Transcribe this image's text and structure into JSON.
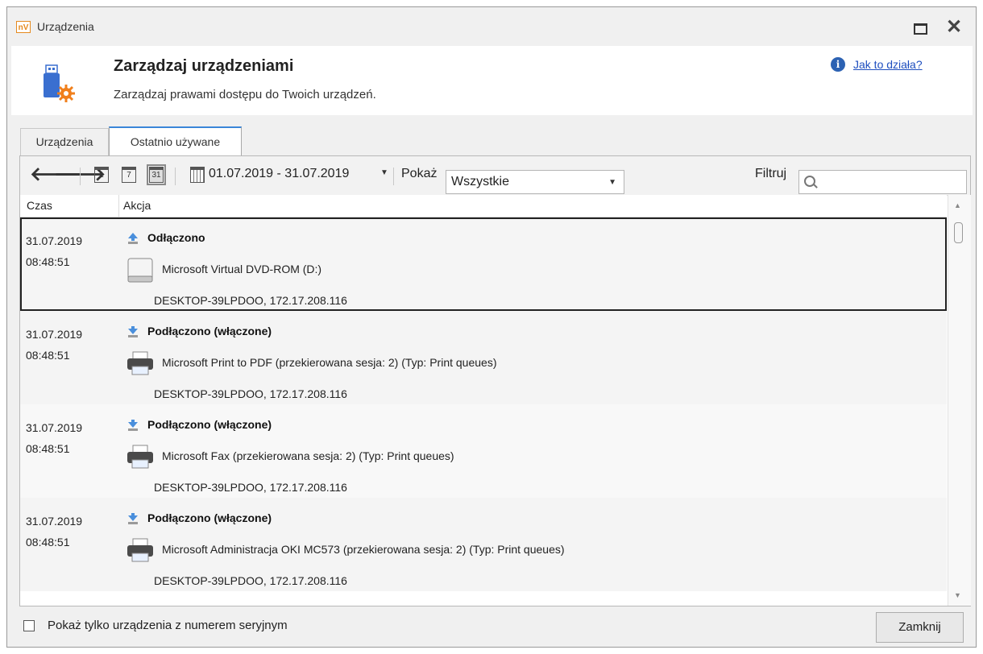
{
  "window": {
    "title": "Urządzenia",
    "logo_text": "nV"
  },
  "header": {
    "title": "Zarządzaj urządzeniami",
    "subtitle": "Zarządzaj prawami dostępu do Twoich urządzeń.",
    "help_link": "Jak to działa?"
  },
  "tabs": [
    {
      "label": "Urządzenia",
      "active": false
    },
    {
      "label": "Ostatnio używane",
      "active": true
    }
  ],
  "toolbar": {
    "calendar_day": "1",
    "calendar_week": "7",
    "calendar_month": "31",
    "date_range": "01.07.2019 - 31.07.2019",
    "show_label": "Pokaż",
    "show_value": "Wszystkie",
    "filter_label": "Filtruj",
    "filter_value": ""
  },
  "columns": {
    "time": "Czas",
    "action": "Akcja"
  },
  "rows": [
    {
      "date": "31.07.2019",
      "time": "08:48:51",
      "action": "Odłączono",
      "action_icon": "eject-icon",
      "device": "Microsoft Virtual DVD-ROM (D:)",
      "device_icon": "drive-icon",
      "host": "DESKTOP-39LPDOO, 172.17.208.116",
      "selected": true
    },
    {
      "date": "31.07.2019",
      "time": "08:48:51",
      "action": "Podłączono (włączone)",
      "action_icon": "connect-icon",
      "device": "Microsoft Print to PDF (przekierowana sesja: 2) (Typ: Print queues)",
      "device_icon": "printer-icon",
      "host": "DESKTOP-39LPDOO, 172.17.208.116",
      "selected": false
    },
    {
      "date": "31.07.2019",
      "time": "08:48:51",
      "action": "Podłączono (włączone)",
      "action_icon": "connect-icon",
      "device": "Microsoft Fax (przekierowana sesja: 2) (Typ: Print queues)",
      "device_icon": "printer-icon",
      "host": "DESKTOP-39LPDOO, 172.17.208.116",
      "selected": false
    },
    {
      "date": "31.07.2019",
      "time": "08:48:51",
      "action": "Podłączono (włączone)",
      "action_icon": "connect-icon",
      "device": "Microsoft Administracja OKI MC573 (przekierowana sesja: 2) (Typ: Print queues)",
      "device_icon": "printer-icon",
      "host": "DESKTOP-39LPDOO, 172.17.208.116",
      "selected": false
    }
  ],
  "footer": {
    "checkbox_label": "Pokaż tylko urządzenia z numerem seryjnym",
    "checkbox_checked": false,
    "close_button": "Zamknij"
  },
  "colors": {
    "accent": "#3a86d8",
    "link": "#1f4fbf",
    "gear": "#f07f1c",
    "usb": "#3a6fd0"
  }
}
